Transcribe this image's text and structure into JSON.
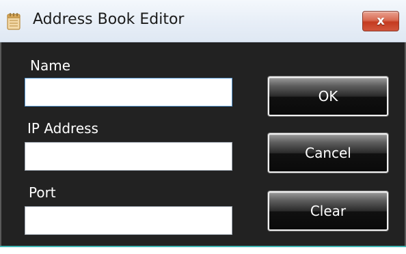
{
  "window": {
    "title": "Address Book Editor",
    "icon": "notepad-icon",
    "close_label": "x"
  },
  "form": {
    "name": {
      "label": "Name",
      "value": ""
    },
    "ip_address": {
      "label": "IP Address",
      "value": ""
    },
    "port": {
      "label": "Port",
      "value": ""
    }
  },
  "buttons": {
    "ok": "OK",
    "cancel": "Cancel",
    "clear": "Clear"
  },
  "colors": {
    "client_background": "#222222",
    "accent_border": "#3fb6b4",
    "close_button": "#d2553b"
  }
}
